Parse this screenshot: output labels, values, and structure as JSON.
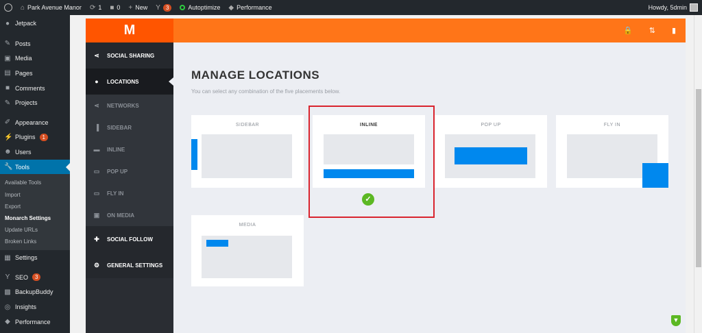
{
  "adminbar": {
    "site_name": "Park Avenue Manor",
    "updates_count": "1",
    "comments_count": "0",
    "new_label": "New",
    "yoast_badge": "3",
    "autoptimize_label": "Autoptimize",
    "performance_label": "Performance",
    "howdy": "Howdy, 5dmin"
  },
  "wpmenu": {
    "items": [
      {
        "label": "Jetpack",
        "icon": "jetpack-icon"
      },
      {
        "label": "Posts",
        "icon": "pin-icon"
      },
      {
        "label": "Media",
        "icon": "media-icon"
      },
      {
        "label": "Pages",
        "icon": "pages-icon"
      },
      {
        "label": "Comments",
        "icon": "comment-icon"
      },
      {
        "label": "Projects",
        "icon": "pin-icon"
      },
      {
        "label": "Appearance",
        "icon": "brush-icon"
      },
      {
        "label": "Plugins",
        "icon": "plug-icon",
        "badge": "1"
      },
      {
        "label": "Users",
        "icon": "user-icon"
      },
      {
        "label": "Tools",
        "icon": "wrench-icon"
      }
    ],
    "tools_submenu": [
      "Available Tools",
      "Import",
      "Export",
      "Monarch Settings",
      "Update URLs",
      "Broken Links"
    ],
    "lower_items": [
      {
        "label": "Settings",
        "icon": "settings-icon"
      },
      {
        "label": "SEO",
        "icon": "yoast-icon",
        "badge": "3"
      },
      {
        "label": "BackupBuddy",
        "icon": "backup-icon"
      },
      {
        "label": "Insights",
        "icon": "insights-icon"
      },
      {
        "label": "Performance",
        "icon": "performance-icon"
      }
    ]
  },
  "monarch": {
    "logo": "M",
    "nav": {
      "social_sharing": "Social Sharing",
      "locations": "Locations",
      "networks": "Networks",
      "sidebar": "Sidebar",
      "inline": "Inline",
      "popup": "Pop Up",
      "flyin": "Fly In",
      "onmedia": "On Media",
      "social_follow": "Social Follow",
      "general_settings": "General Settings"
    },
    "title": "MANAGE LOCATIONS",
    "subtitle": "You can select any combination of the five placements below.",
    "cards": {
      "sidebar": "SIDEBAR",
      "inline": "INLINE",
      "popup": "POP UP",
      "flyin": "FLY IN",
      "media": "MEDIA"
    },
    "accent": "#ff7518",
    "selected_color": "#5cb823"
  }
}
